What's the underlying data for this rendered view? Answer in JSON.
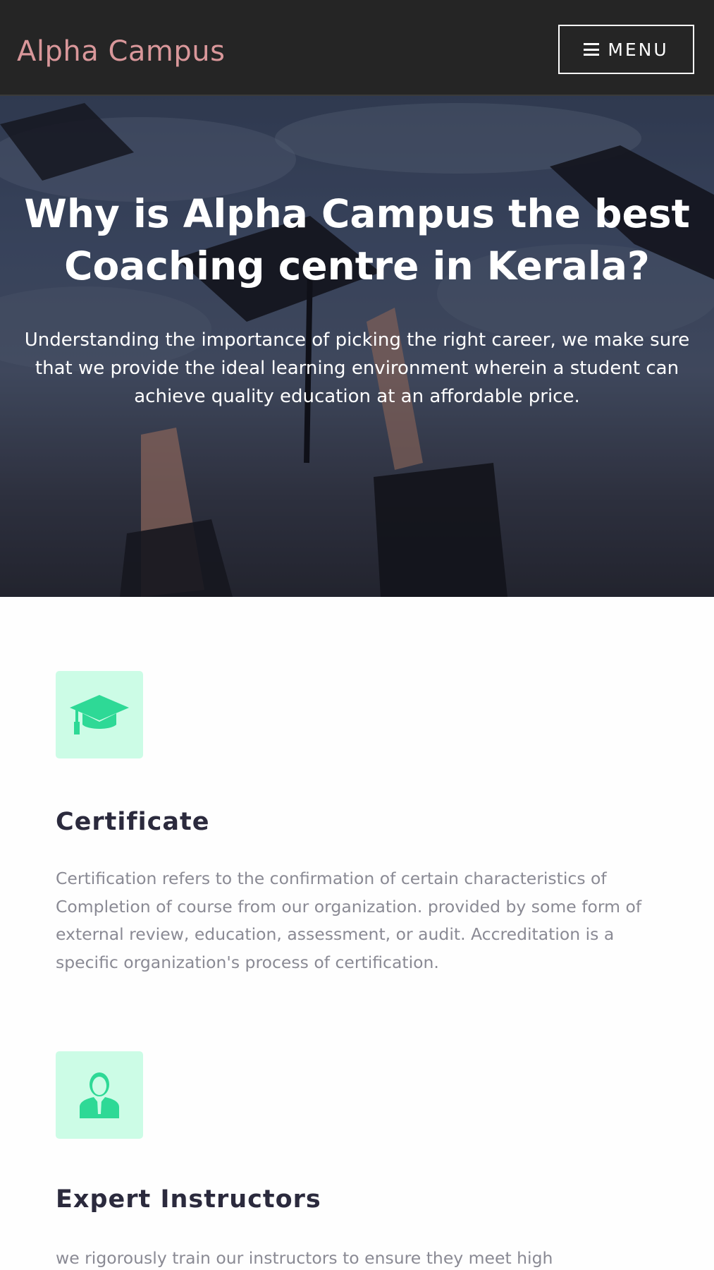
{
  "header": {
    "logo": "Alpha Campus",
    "menu_label": "MENU"
  },
  "hero": {
    "title": "Why is Alpha Campus the best Coaching centre in Kerala?",
    "text": "Understanding the importance of picking the right career, we make sure that we provide the ideal learning environment wherein a student can achieve quality education at an affordable price."
  },
  "features": [
    {
      "icon": "graduation-cap-icon",
      "title": "Certificate",
      "description": "Certification refers to the confirmation of certain characteristics of Completion of course from our organization. provided by some form of external review, education, assessment, or audit. Accreditation is a specific organization's process of certification."
    },
    {
      "icon": "instructor-icon",
      "title": "Expert Instructors",
      "description": "we rigorously train our instructors to ensure they meet high"
    }
  ],
  "colors": {
    "header_bg": "#252525",
    "logo": "#d9979a",
    "icon_accent": "#2ed996",
    "icon_box_bg": "#ccfce6",
    "feature_title": "#2b2a3d",
    "feature_text": "#8a8a94"
  }
}
